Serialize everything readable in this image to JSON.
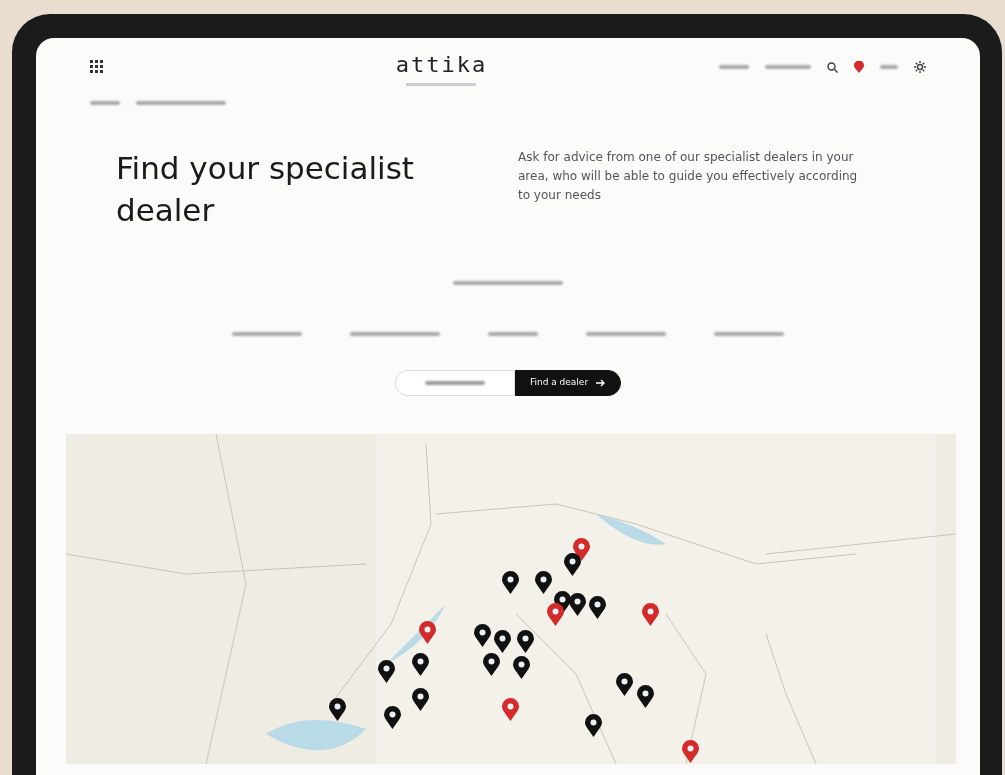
{
  "header": {
    "logo": "attika"
  },
  "intro": {
    "title": "Find your specialist dealer",
    "text": "Ask for advice from one of our specialist dealers in your area, who will be able to guide you effectively according to your needs"
  },
  "mode_tabs": [
    {
      "selected": false
    },
    {
      "label": "Find a dealer",
      "selected": true
    }
  ],
  "map": {
    "pins": [
      {
        "color": "#d42a2a"
      },
      {
        "color": "#111111"
      },
      {
        "color": "#111111"
      },
      {
        "color": "#111111"
      },
      {
        "color": "#111111"
      },
      {
        "color": "#111111"
      },
      {
        "color": "#111111"
      },
      {
        "color": "#d42a2a"
      },
      {
        "color": "#d42a2a"
      },
      {
        "color": "#d42a2a"
      },
      {
        "color": "#111111"
      },
      {
        "color": "#111111"
      },
      {
        "color": "#111111"
      },
      {
        "color": "#111111"
      },
      {
        "color": "#111111"
      },
      {
        "color": "#111111"
      },
      {
        "color": "#111111"
      },
      {
        "color": "#111111"
      },
      {
        "color": "#111111"
      },
      {
        "color": "#d42a2a"
      },
      {
        "color": "#111111"
      },
      {
        "color": "#111111"
      },
      {
        "color": "#111111"
      },
      {
        "color": "#d42a2a"
      },
      {
        "color": "#111111"
      }
    ]
  }
}
